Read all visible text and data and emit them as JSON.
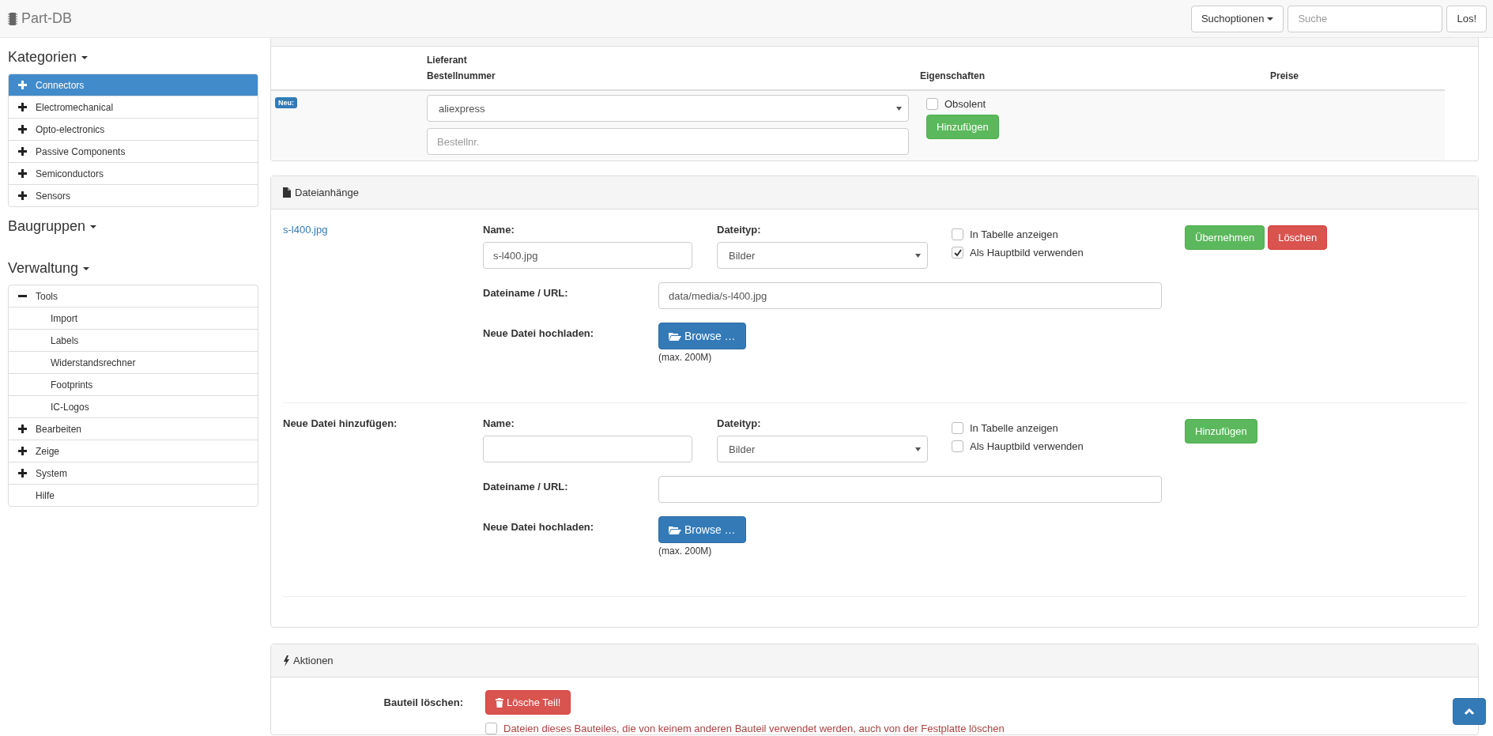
{
  "navbar": {
    "brand": "Part-DB",
    "search_options": "Suchoptionen",
    "search": {
      "placeholder": "Suche"
    },
    "go_button": "Los!"
  },
  "sidebar": [
    {
      "title": "Kategorien",
      "items": [
        {
          "label": "Connectors",
          "kind": "branch",
          "expanded": false,
          "selected": true
        },
        {
          "label": "Electromechanical",
          "kind": "branch",
          "expanded": false,
          "selected": false
        },
        {
          "label": "Opto-electronics",
          "kind": "branch",
          "expanded": false,
          "selected": false
        },
        {
          "label": "Passive Components",
          "kind": "branch",
          "expanded": false,
          "selected": false
        },
        {
          "label": "Semiconductors",
          "kind": "branch",
          "expanded": false,
          "selected": false
        },
        {
          "label": "Sensors",
          "kind": "branch",
          "expanded": false,
          "selected": false
        }
      ]
    },
    {
      "title": "Baugruppen"
    },
    {
      "title": "Verwaltung",
      "items": [
        {
          "label": "Tools",
          "kind": "branch",
          "expanded": true,
          "selected": false,
          "children": [
            {
              "label": "Import",
              "kind": "leaf",
              "selected": false
            },
            {
              "label": "Labels",
              "kind": "leaf",
              "selected": false
            },
            {
              "label": "Widerstandsrechner",
              "kind": "leaf",
              "selected": false
            },
            {
              "label": "Footprints",
              "kind": "leaf",
              "selected": false
            },
            {
              "label": "IC-Logos",
              "kind": "leaf",
              "selected": false
            }
          ]
        },
        {
          "label": "Bearbeiten",
          "kind": "branch",
          "expanded": false,
          "selected": false
        },
        {
          "label": "Zeige",
          "kind": "branch",
          "expanded": false,
          "selected": false
        },
        {
          "label": "System",
          "kind": "branch",
          "expanded": false,
          "selected": false
        },
        {
          "label": "Hilfe",
          "kind": "leaf",
          "selected": false
        }
      ]
    }
  ],
  "orders": {
    "columns": [
      [
        "Lieferant",
        "Bestellnummer"
      ],
      [
        "Eigenschaften"
      ],
      [
        "Preise"
      ]
    ],
    "new_row": {
      "badge": "Neu:",
      "supplier": "aliexpress",
      "order_number": {
        "placeholder": "Bestellnr."
      },
      "obsolete": {
        "label": "Obsolent",
        "checked": false
      },
      "button": "Hinzufügen"
    }
  },
  "attachments": {
    "title": "Dateianhänge",
    "entries": [
      {
        "kind": "existing",
        "heading": "s-l400.jpg",
        "name_label": "Name:",
        "name_value": "s-l400.jpg",
        "type_label": "Dateityp:",
        "type_value": "Bilder",
        "checks": [
          {
            "label": "In Tabelle anzeigen",
            "checked": false
          },
          {
            "label": "Als Hauptbild verwenden",
            "checked": true
          }
        ],
        "url_label": "Dateiname / URL:",
        "url_value": "data/media/s-l400.jpg",
        "upload_label": "Neue Datei hochladen:",
        "browse": "Browse …",
        "max": "(max. 200M)",
        "buttons": [
          {
            "label": "Übernehmen",
            "kind": "success"
          },
          {
            "label": "Löschen",
            "kind": "danger"
          }
        ]
      },
      {
        "kind": "new",
        "heading": "Neue Datei hinzufügen:",
        "name_label": "Name:",
        "type_label": "Dateityp:",
        "type_value": "Bilder",
        "checks": [
          {
            "label": "In Tabelle anzeigen",
            "checked": false
          },
          {
            "label": "Als Hauptbild verwenden",
            "checked": false
          }
        ],
        "url_label": "Dateiname / URL:",
        "upload_label": "Neue Datei hochladen:",
        "browse": "Browse …",
        "max": "(max. 200M)",
        "buttons": [
          {
            "label": "Hinzufügen",
            "kind": "success"
          }
        ]
      }
    ]
  },
  "actions": {
    "title": "Aktionen",
    "delete_label": "Bauteil löschen:",
    "delete_button": "Lösche Teil!",
    "delete_files": {
      "label": "Dateien dieses Bauteiles, die von keinem anderen Bauteil verwendet werden, auch von der Festplatte löschen",
      "checked": false
    }
  }
}
